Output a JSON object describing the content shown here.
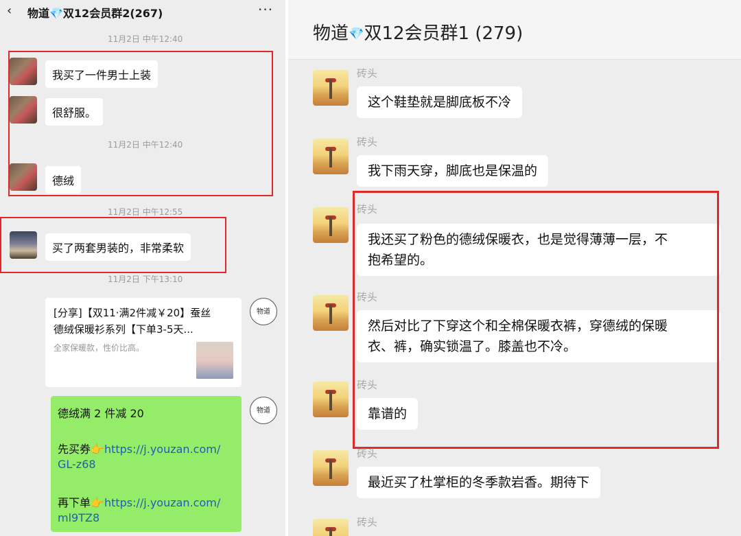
{
  "left": {
    "title": "物道💎双12会员群2(267)",
    "back_icon": "‹",
    "more_icon": "···",
    "messages": [
      {
        "time": "11月2日 中午12:40",
        "text": "我买了一件男士上装"
      },
      {
        "text": "很舒服。"
      },
      {
        "time": "11月2日 中午12:40",
        "text": "德绒"
      },
      {
        "time": "11月2日 中午12:55",
        "text": "买了两套男装的，非常柔软"
      },
      {
        "time": "11月2日 下午13:10"
      }
    ],
    "share": {
      "title_line1": "[分享]【双11·满2件减￥20】蚕丝",
      "title_line2": "德绒保暖衫系列【下单3-5天...",
      "desc": "全家保暖款，性价比高。"
    },
    "logo_text": "物道",
    "green": {
      "line1": "德绒满 2 件减 20",
      "line2_prefix": "先买券👉",
      "line2_link": "https://j.youzan.com/",
      "line3": "GL-z68",
      "line4_prefix": "再下单👉",
      "line4_link": "https://j.youzan.com/",
      "line5": "ml9TZ8"
    }
  },
  "right": {
    "title_a": "物道",
    "title_diamond": "💎",
    "title_b": "双12会员群1 (279)",
    "sender": "砖头",
    "messages": [
      {
        "lines": [
          "这个鞋垫就是脚底板不冷"
        ]
      },
      {
        "lines": [
          "我下雨天穿，脚底也是保温的"
        ]
      },
      {
        "lines": [
          "我还买了粉色的德绒保暖衣，也是觉得薄薄一层，不",
          "抱希望的。"
        ]
      },
      {
        "lines": [
          "然后对比了下穿这个和全棉保暖衣裤，穿德绒的保暖",
          "衣、裤，确实锁温了。膝盖也不冷。"
        ]
      },
      {
        "lines": [
          "靠谱的"
        ]
      },
      {
        "lines": [
          "最近买了杜掌柜的冬季款岩香。期待下"
        ]
      }
    ]
  },
  "colors": {
    "highlight": "#e02a2a",
    "green_bubble": "#95ec69",
    "link": "#1f5fb3"
  }
}
